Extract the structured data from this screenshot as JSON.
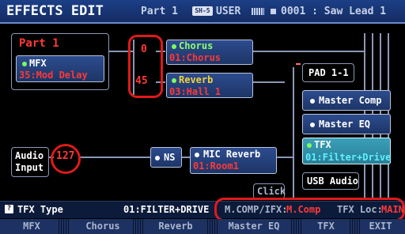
{
  "header": {
    "title": "EFFECTS EDIT",
    "part": "Part 1",
    "scene_badge": "SH-5",
    "user": "USER",
    "tone": "0001 : Saw Lead 1"
  },
  "diagram": {
    "part_label": "Part 1",
    "mfx_label": "MFX",
    "mfx_type": "35:Mod Delay",
    "chorus_send": "0",
    "reverb_send": "45",
    "chorus_label": "Chorus",
    "chorus_type": "01:Chorus",
    "reverb_label": "Reverb",
    "reverb_type": "03:Hall 1",
    "pad_label": "PAD 1-1",
    "master_comp": "Master Comp",
    "master_eq": "Master EQ",
    "tfx_label": "TFX",
    "tfx_type": "01:Filter+Drive",
    "usb_audio": "USB Audio",
    "audio_input_line1": "Audio",
    "audio_input_line2": "Input",
    "audio_level": "127",
    "ns_label": "NS",
    "mic_reverb_label": "MIC Reverb",
    "mic_reverb_type": "01:Room1",
    "click_label": "Click"
  },
  "info_bar": {
    "param_name": "TFX Type",
    "param_value": "01:FILTER+DRIVE",
    "mcomp_label": "M.COMP/IFX:",
    "mcomp_value": "M.Comp",
    "tfx_loc_label": "TFX Loc:",
    "tfx_loc_value": "MAIN"
  },
  "tabs": [
    "MFX",
    "Chorus",
    "Reverb",
    "Master EQ",
    "TFX",
    "EXIT"
  ],
  "colors": {
    "header_bg": "#1c3f86",
    "red_text": "#ff3838",
    "green_text": "#8cff70",
    "yellow_text": "#f0d23a",
    "highlight_ring": "#e01a1a",
    "tfx_cyan": "#5fe0f0"
  }
}
